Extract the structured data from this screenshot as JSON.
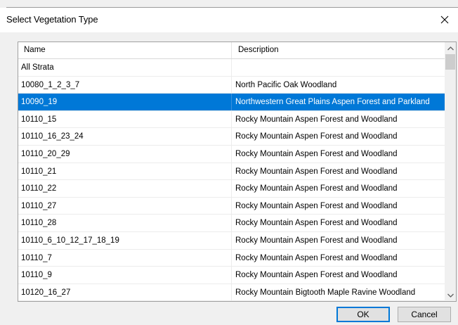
{
  "window": {
    "title": "Select Vegetation Type"
  },
  "table": {
    "columns": [
      "Name",
      "Description"
    ],
    "selected_index": 2,
    "rows": [
      {
        "name": "All Strata",
        "description": ""
      },
      {
        "name": "10080_1_2_3_7",
        "description": "North Pacific Oak Woodland"
      },
      {
        "name": "10090_19",
        "description": "Northwestern Great Plains Aspen Forest and Parkland"
      },
      {
        "name": "10110_15",
        "description": "Rocky Mountain Aspen Forest and Woodland"
      },
      {
        "name": "10110_16_23_24",
        "description": "Rocky Mountain Aspen Forest and Woodland"
      },
      {
        "name": "10110_20_29",
        "description": "Rocky Mountain Aspen Forest and Woodland"
      },
      {
        "name": "10110_21",
        "description": "Rocky Mountain Aspen Forest and Woodland"
      },
      {
        "name": "10110_22",
        "description": "Rocky Mountain Aspen Forest and Woodland"
      },
      {
        "name": "10110_27",
        "description": "Rocky Mountain Aspen Forest and Woodland"
      },
      {
        "name": "10110_28",
        "description": "Rocky Mountain Aspen Forest and Woodland"
      },
      {
        "name": "10110_6_10_12_17_18_19",
        "description": "Rocky Mountain Aspen Forest and Woodland"
      },
      {
        "name": "10110_7",
        "description": "Rocky Mountain Aspen Forest and Woodland"
      },
      {
        "name": "10110_9",
        "description": "Rocky Mountain Aspen Forest and Woodland"
      },
      {
        "name": "10120_16_27",
        "description": "Rocky Mountain Bigtooth Maple Ravine Woodland"
      }
    ]
  },
  "buttons": {
    "ok": "OK",
    "cancel": "Cancel"
  },
  "icons": {
    "close": "close-icon",
    "scroll_up": "chevron-up-icon",
    "scroll_down": "chevron-down-icon"
  },
  "colors": {
    "selection": "#0078d7",
    "default_button_border": "#0078d7"
  }
}
